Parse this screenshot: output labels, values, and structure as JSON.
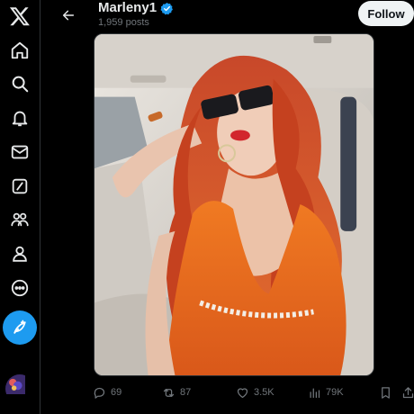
{
  "nav": {
    "items": [
      {
        "name": "x-logo-icon"
      },
      {
        "name": "home-icon"
      },
      {
        "name": "search-icon"
      },
      {
        "name": "notifications-icon"
      },
      {
        "name": "messages-icon"
      },
      {
        "name": "grok-icon"
      },
      {
        "name": "communities-icon"
      },
      {
        "name": "profile-icon"
      },
      {
        "name": "more-icon"
      }
    ],
    "post_button_icon": "feather-plus-icon"
  },
  "header": {
    "back_icon": "arrow-left-icon",
    "name": "Marleny1",
    "verified_icon": "verified-badge-icon",
    "posts_count": "1,959 posts",
    "follow_label": "Follow"
  },
  "media": {
    "description_icon": "photo"
  },
  "actions": {
    "replies": "69",
    "reposts": "87",
    "likes": "3.5K",
    "views": "79K"
  },
  "colors": {
    "background": "#000000",
    "accent": "#1d9bf0",
    "text_primary": "#e7e9ea",
    "text_secondary": "#71767b",
    "follow_bg": "#eff3f4"
  }
}
